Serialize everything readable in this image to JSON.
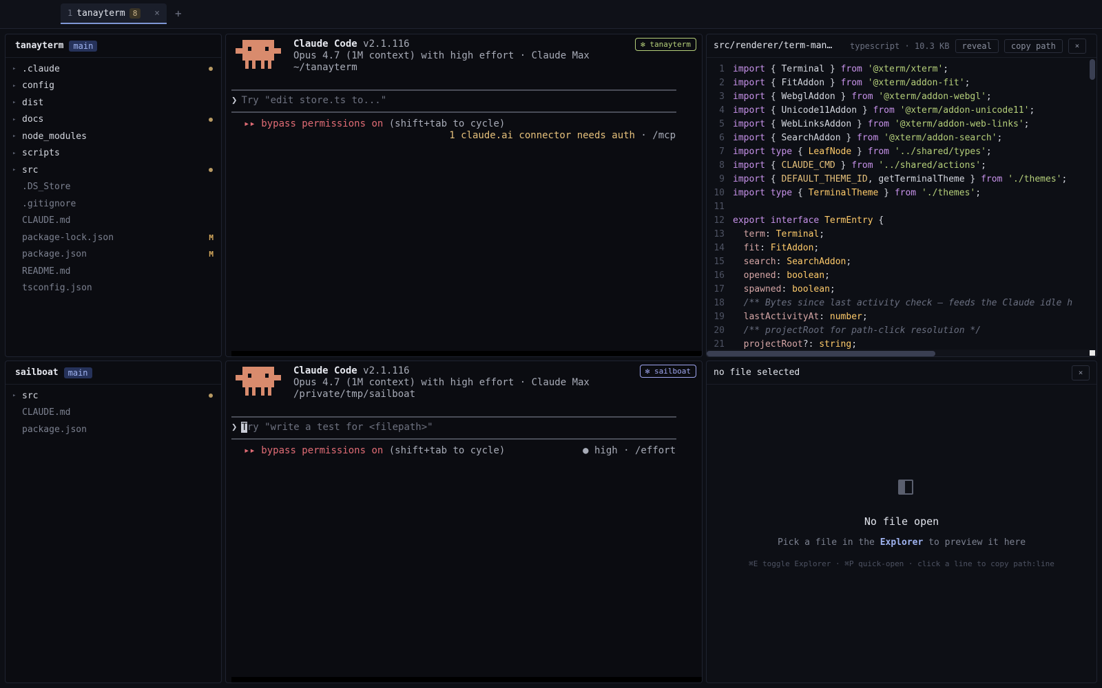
{
  "tabbar": {
    "tab": {
      "number": "1",
      "name": "tanayterm",
      "count": "8",
      "close": "×"
    },
    "add": "+"
  },
  "explorer_top": {
    "repo": "tanayterm",
    "branch": "main",
    "items": [
      {
        "label": ".claude",
        "kind": "folder",
        "marker": "dot"
      },
      {
        "label": "config",
        "kind": "folder",
        "marker": ""
      },
      {
        "label": "dist",
        "kind": "folder",
        "marker": ""
      },
      {
        "label": "docs",
        "kind": "folder",
        "marker": "dot"
      },
      {
        "label": "node_modules",
        "kind": "folder",
        "marker": ""
      },
      {
        "label": "scripts",
        "kind": "folder",
        "marker": ""
      },
      {
        "label": "src",
        "kind": "folder",
        "marker": "dot"
      },
      {
        "label": ".DS_Store",
        "kind": "file",
        "marker": ""
      },
      {
        "label": ".gitignore",
        "kind": "file",
        "marker": ""
      },
      {
        "label": "CLAUDE.md",
        "kind": "file",
        "marker": ""
      },
      {
        "label": "package-lock.json",
        "kind": "file",
        "marker": "M"
      },
      {
        "label": "package.json",
        "kind": "file",
        "marker": "M"
      },
      {
        "label": "README.md",
        "kind": "file",
        "marker": ""
      },
      {
        "label": "tsconfig.json",
        "kind": "file",
        "marker": ""
      }
    ]
  },
  "explorer_bottom": {
    "repo": "sailboat",
    "branch": "main",
    "items": [
      {
        "label": "src",
        "kind": "folder",
        "marker": "dot"
      },
      {
        "label": "CLAUDE.md",
        "kind": "file",
        "marker": ""
      },
      {
        "label": "package.json",
        "kind": "file",
        "marker": ""
      }
    ]
  },
  "term_top": {
    "app": "Claude Code",
    "version": "v2.1.116",
    "model_line": "Opus 4.7 (1M context) with high effort · Claude Max",
    "cwd": "~/tanayterm",
    "badge": "✻ tanayterm",
    "badge_color": "#b5cf7a",
    "prompt_caret": "❯",
    "prompt_placeholder": "Try \"edit store.ts to...\"",
    "status_arrows": "▸▸",
    "status_bypass": "bypass permissions on",
    "status_hint": "(shift+tab to cycle)",
    "notice": "1 claude.ai connector needs auth",
    "notice_sep": " · ",
    "notice_cmd": "/mcp"
  },
  "term_bottom": {
    "app": "Claude Code",
    "version": "v2.1.116",
    "model_line": "Opus 4.7 (1M context) with high effort · Claude Max",
    "cwd": "/private/tmp/sailboat",
    "badge": "✻ sailboat",
    "badge_color": "#9fa6f0",
    "prompt_caret": "❯",
    "prompt_cursor_char": "T",
    "prompt_placeholder_rest": "ry \"write a test for <filepath>\"",
    "status_arrows": "▸▸",
    "status_bypass": "bypass permissions on",
    "status_hint": "(shift+tab to cycle)",
    "effort": "● high · /effort"
  },
  "code_panel": {
    "path": "src/renderer/term-man…",
    "meta": "typescript · 10.3 KB",
    "reveal": "reveal",
    "copy_path": "copy path",
    "close": "×",
    "lines": [
      [
        [
          "k",
          "import"
        ],
        [
          "tx",
          " { "
        ],
        [
          "tx",
          "Terminal"
        ],
        [
          "tx",
          " } "
        ],
        [
          "k",
          "from"
        ],
        [
          "tx",
          " "
        ],
        [
          "s",
          "'@xterm/xterm'"
        ],
        [
          "tx",
          ";"
        ]
      ],
      [
        [
          "k",
          "import"
        ],
        [
          "tx",
          " { "
        ],
        [
          "tx",
          "FitAddon"
        ],
        [
          "tx",
          " } "
        ],
        [
          "k",
          "from"
        ],
        [
          "tx",
          " "
        ],
        [
          "s",
          "'@xterm/addon-fit'"
        ],
        [
          "tx",
          ";"
        ]
      ],
      [
        [
          "k",
          "import"
        ],
        [
          "tx",
          " { "
        ],
        [
          "tx",
          "WebglAddon"
        ],
        [
          "tx",
          " } "
        ],
        [
          "k",
          "from"
        ],
        [
          "tx",
          " "
        ],
        [
          "s",
          "'@xterm/addon-webgl'"
        ],
        [
          "tx",
          ";"
        ]
      ],
      [
        [
          "k",
          "import"
        ],
        [
          "tx",
          " { "
        ],
        [
          "tx",
          "Unicode11Addon"
        ],
        [
          "tx",
          " } "
        ],
        [
          "k",
          "from"
        ],
        [
          "tx",
          " "
        ],
        [
          "s",
          "'@xterm/addon-unicode11'"
        ],
        [
          "tx",
          ";"
        ]
      ],
      [
        [
          "k",
          "import"
        ],
        [
          "tx",
          " { "
        ],
        [
          "tx",
          "WebLinksAddon"
        ],
        [
          "tx",
          " } "
        ],
        [
          "k",
          "from"
        ],
        [
          "tx",
          " "
        ],
        [
          "s",
          "'@xterm/addon-web-links'"
        ],
        [
          "tx",
          ";"
        ]
      ],
      [
        [
          "k",
          "import"
        ],
        [
          "tx",
          " { "
        ],
        [
          "tx",
          "SearchAddon"
        ],
        [
          "tx",
          " } "
        ],
        [
          "k",
          "from"
        ],
        [
          "tx",
          " "
        ],
        [
          "s",
          "'@xterm/addon-search'"
        ],
        [
          "tx",
          ";"
        ]
      ],
      [
        [
          "k",
          "import"
        ],
        [
          "tx",
          " "
        ],
        [
          "k",
          "type"
        ],
        [
          "tx",
          " { "
        ],
        [
          "t",
          "LeafNode"
        ],
        [
          "tx",
          " } "
        ],
        [
          "k",
          "from"
        ],
        [
          "tx",
          " "
        ],
        [
          "s",
          "'../shared/types'"
        ],
        [
          "tx",
          ";"
        ]
      ],
      [
        [
          "k",
          "import"
        ],
        [
          "tx",
          " { "
        ],
        [
          "f",
          "CLAUDE_CMD"
        ],
        [
          "tx",
          " } "
        ],
        [
          "k",
          "from"
        ],
        [
          "tx",
          " "
        ],
        [
          "s",
          "'../shared/actions'"
        ],
        [
          "tx",
          ";"
        ]
      ],
      [
        [
          "k",
          "import"
        ],
        [
          "tx",
          " { "
        ],
        [
          "f",
          "DEFAULT_THEME_ID"
        ],
        [
          "tx",
          ", getTerminalTheme } "
        ],
        [
          "k",
          "from"
        ],
        [
          "tx",
          " "
        ],
        [
          "s",
          "'./themes'"
        ],
        [
          "tx",
          ";"
        ]
      ],
      [
        [
          "k",
          "import"
        ],
        [
          "tx",
          " "
        ],
        [
          "k",
          "type"
        ],
        [
          "tx",
          " { "
        ],
        [
          "t",
          "TerminalTheme"
        ],
        [
          "tx",
          " } "
        ],
        [
          "k",
          "from"
        ],
        [
          "tx",
          " "
        ],
        [
          "s",
          "'./themes'"
        ],
        [
          "tx",
          ";"
        ]
      ],
      [],
      [
        [
          "k",
          "export"
        ],
        [
          "tx",
          " "
        ],
        [
          "k",
          "interface"
        ],
        [
          "tx",
          " "
        ],
        [
          "t",
          "TermEntry"
        ],
        [
          "tx",
          " {"
        ]
      ],
      [
        [
          "tx",
          "  "
        ],
        [
          "p",
          "term"
        ],
        [
          "tx",
          ": "
        ],
        [
          "t",
          "Terminal"
        ],
        [
          "tx",
          ";"
        ]
      ],
      [
        [
          "tx",
          "  "
        ],
        [
          "p",
          "fit"
        ],
        [
          "tx",
          ": "
        ],
        [
          "t",
          "FitAddon"
        ],
        [
          "tx",
          ";"
        ]
      ],
      [
        [
          "tx",
          "  "
        ],
        [
          "p",
          "search"
        ],
        [
          "tx",
          ": "
        ],
        [
          "t",
          "SearchAddon"
        ],
        [
          "tx",
          ";"
        ]
      ],
      [
        [
          "tx",
          "  "
        ],
        [
          "p",
          "opened"
        ],
        [
          "tx",
          ": "
        ],
        [
          "t",
          "boolean"
        ],
        [
          "tx",
          ";"
        ]
      ],
      [
        [
          "tx",
          "  "
        ],
        [
          "p",
          "spawned"
        ],
        [
          "tx",
          ": "
        ],
        [
          "t",
          "boolean"
        ],
        [
          "tx",
          ";"
        ]
      ],
      [
        [
          "c",
          "  /** Bytes since last activity check — feeds the Claude idle h"
        ]
      ],
      [
        [
          "tx",
          "  "
        ],
        [
          "p",
          "lastActivityAt"
        ],
        [
          "tx",
          ": "
        ],
        [
          "t",
          "number"
        ],
        [
          "tx",
          ";"
        ]
      ],
      [
        [
          "c",
          "  /** projectRoot for path-click resolution */"
        ]
      ],
      [
        [
          "tx",
          "  "
        ],
        [
          "p",
          "projectRoot"
        ],
        [
          "tx",
          "?: "
        ],
        [
          "t",
          "string"
        ],
        [
          "tx",
          ";"
        ]
      ]
    ]
  },
  "empty_panel": {
    "header": "no file selected",
    "close": "×",
    "title": "No file open",
    "sub_before": "Pick a file in the ",
    "sub_link": "Explorer",
    "sub_after": " to preview it here",
    "hint": "⌘E toggle Explorer · ⌘P quick-open · click a line to copy path:line"
  }
}
